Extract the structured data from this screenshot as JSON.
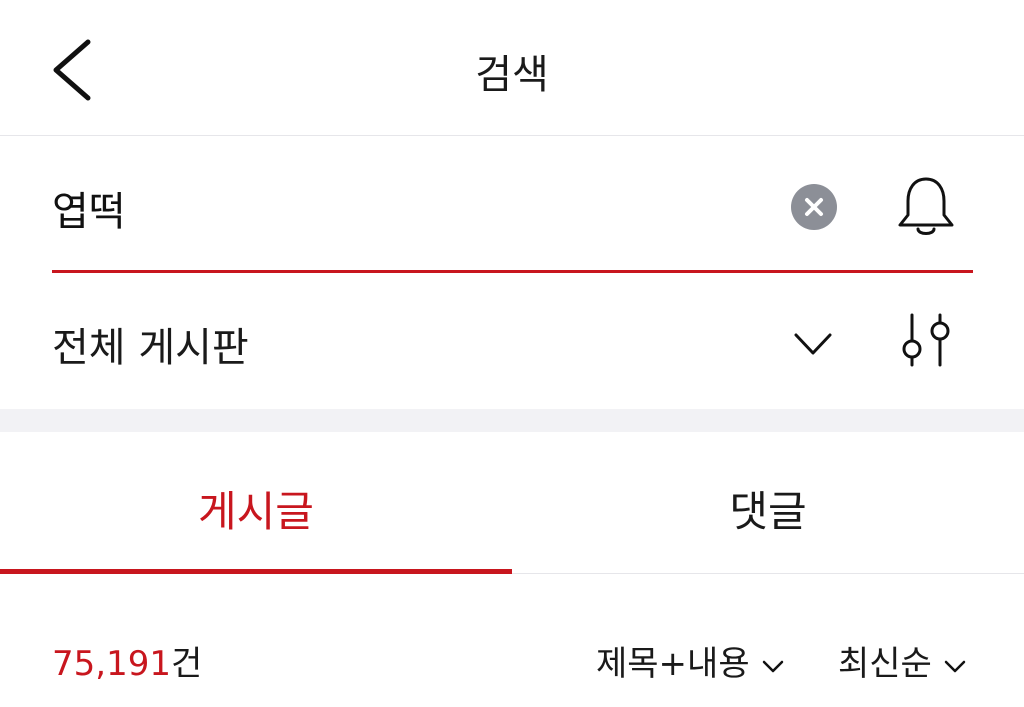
{
  "header": {
    "title": "검색",
    "back_icon": "chevron-left-icon"
  },
  "search": {
    "value": "엽떡",
    "clear_icon": "clear-circle-icon",
    "alert_icon": "bell-icon",
    "accent_color": "#c8161e"
  },
  "board": {
    "selected": "전체 게시판",
    "dropdown_icon": "chevron-down-icon",
    "filter_icon": "sliders-icon"
  },
  "tabs": [
    {
      "label": "게시글",
      "active": true
    },
    {
      "label": "댓글",
      "active": false
    }
  ],
  "results": {
    "count": "75,191",
    "count_suffix": "건",
    "sort_field": "제목+내용",
    "sort_order": "최신순"
  }
}
